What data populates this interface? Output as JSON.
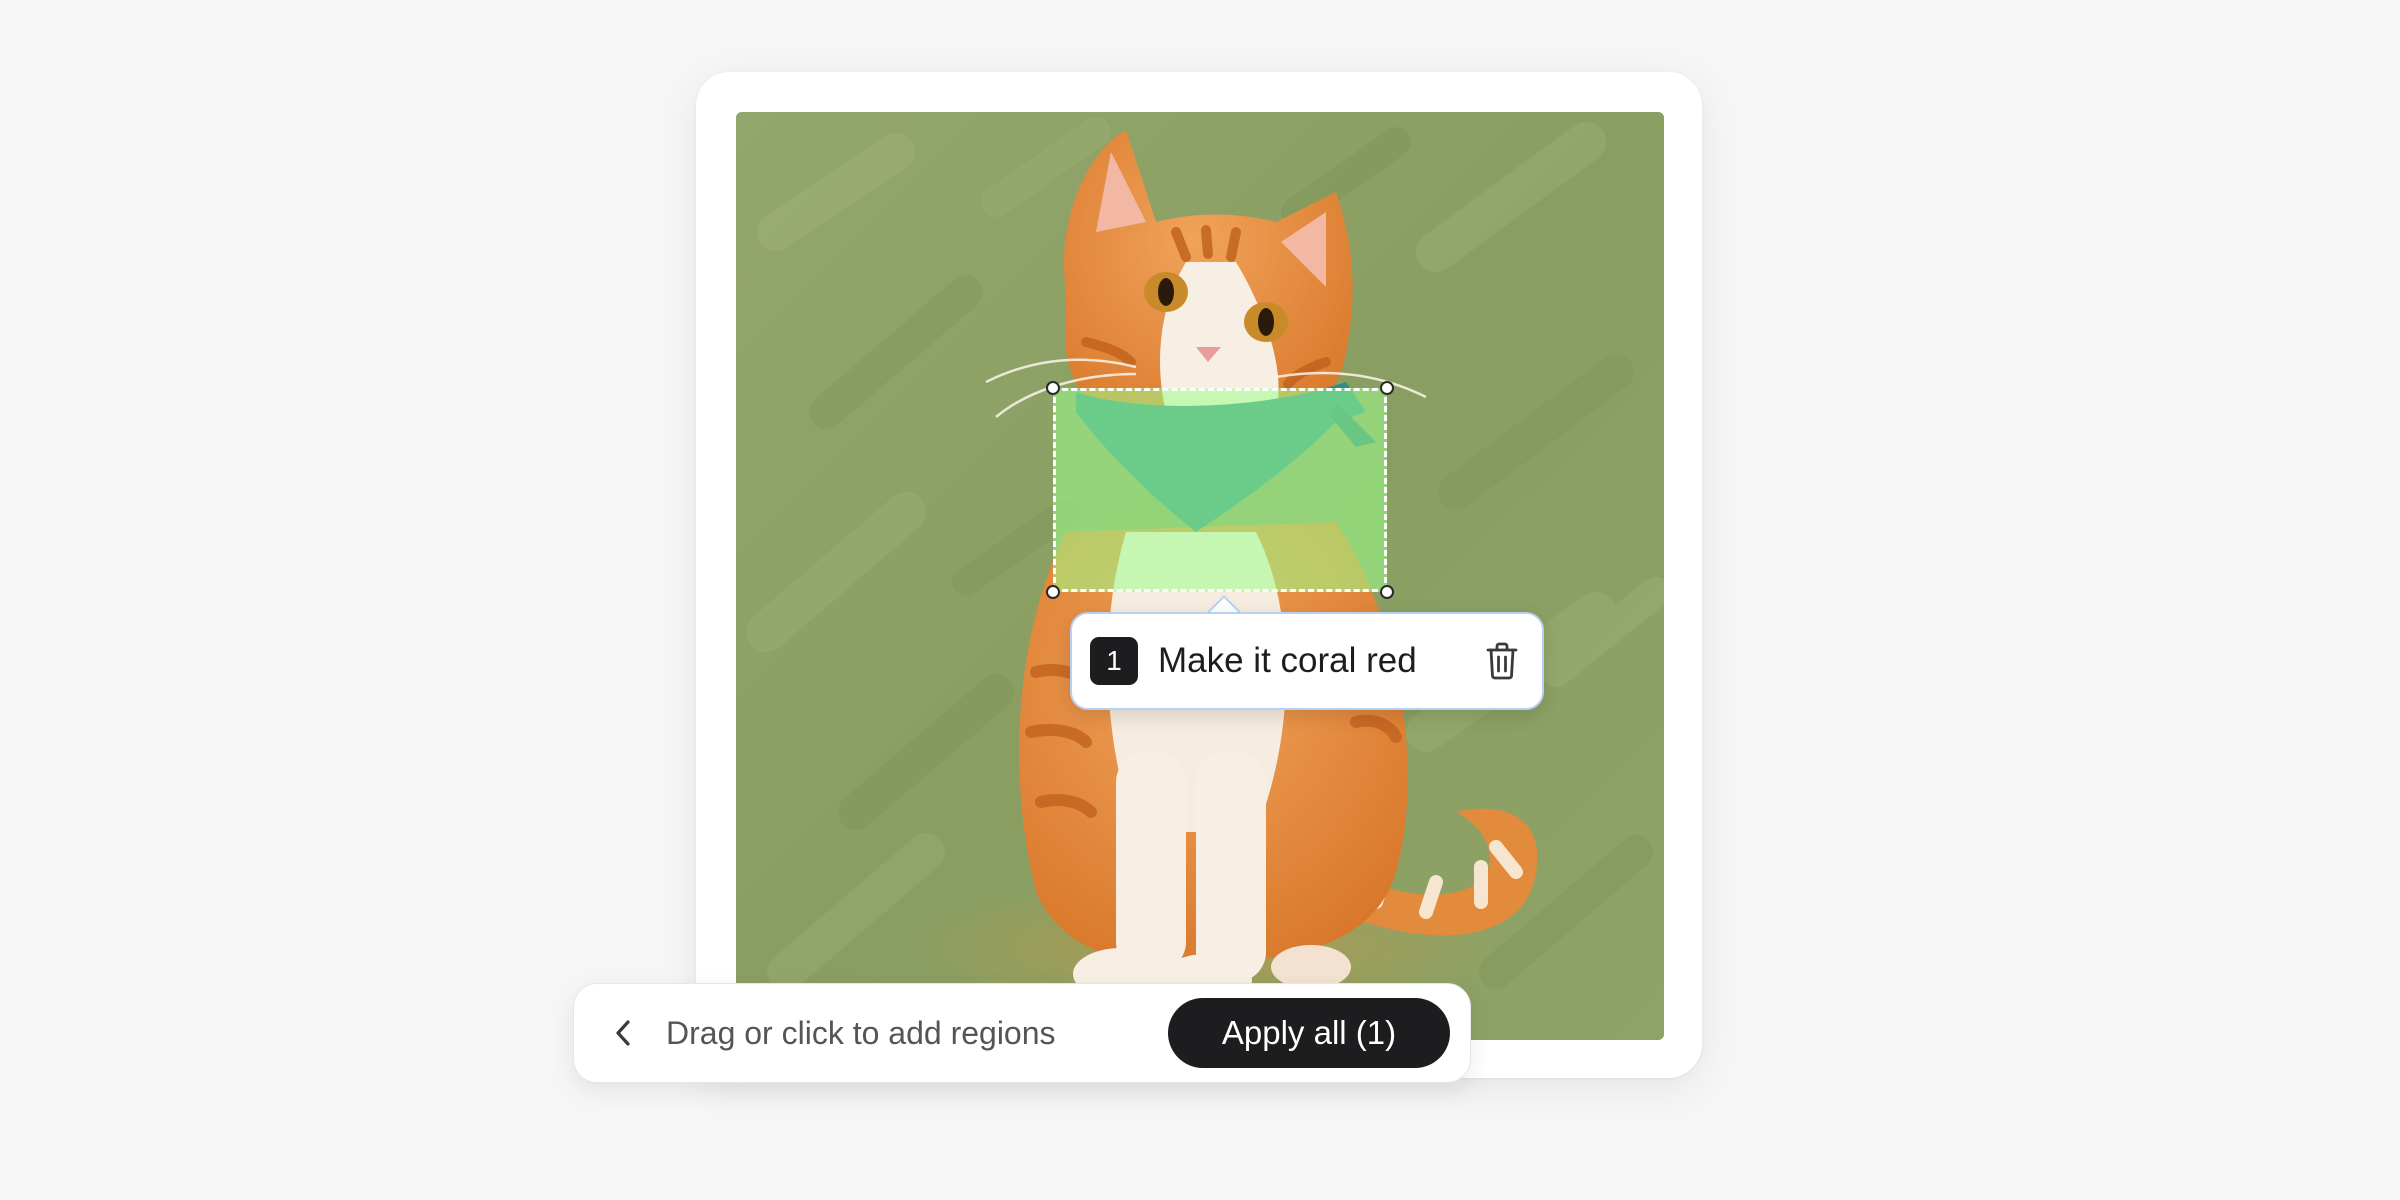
{
  "canvas": {
    "image_alt": "Orange tabby cat wearing a teal bandana, painted on a green brushstroke background"
  },
  "region": {
    "number": "1",
    "prompt": "Make it coral red",
    "delete_icon": "trash-icon",
    "highlight_color": "#9cff8c"
  },
  "toolbar": {
    "back_icon": "chevron-left-icon",
    "hint": "Drag or click to add regions",
    "apply_label": "Apply all (1)"
  },
  "colors": {
    "accent_dark": "#1d1d1f",
    "popover_border": "#b9cff0",
    "background": "#f6f6f7"
  }
}
